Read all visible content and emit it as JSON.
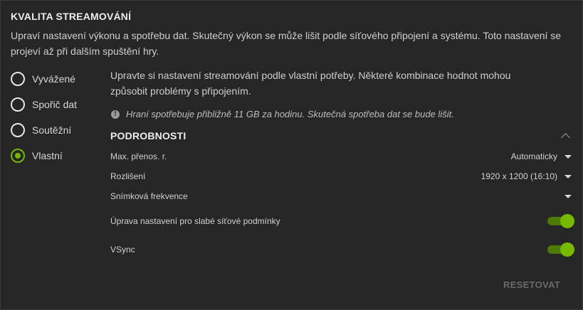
{
  "section": {
    "title": "KVALITA STREAMOVÁNÍ",
    "description": "Upraví nastavení výkonu a spotřebu dat. Skutečný výkon se může lišit podle síťového připojení a systému. Toto nastavení se projeví až při dalším spuštění hry."
  },
  "presets": [
    {
      "label": "Vyvážené",
      "selected": false
    },
    {
      "label": "Spořič dat",
      "selected": false
    },
    {
      "label": "Soutěžní",
      "selected": false
    },
    {
      "label": "Vlastní",
      "selected": true
    }
  ],
  "custom": {
    "description": "Upravte si nastavení streamování podle vlastní potřeby. Některé kombinace hodnot mohou způsobit problémy s připojením.",
    "info": "Hraní spotřebuje přibližně 11 GB za hodinu. Skutečná spotřeba dat se bude lišit.",
    "details_title": "PODROBNOSTI",
    "settings": {
      "bitrate": {
        "label": "Max. přenos. r.",
        "value": "Automaticky"
      },
      "resolution": {
        "label": "Rozlišení",
        "value": "1920 x 1200 (16:10)"
      },
      "framerate": {
        "label": "Snímková frekvence",
        "value": ""
      },
      "poor_network": {
        "label": "Úprava nastavení pro slabé síťové podmínky",
        "enabled": true
      },
      "vsync": {
        "label": "VSync",
        "enabled": true
      }
    }
  },
  "reset_label": "RESETOVAT",
  "colors": {
    "accent": "#76b900",
    "background": "#262626"
  }
}
